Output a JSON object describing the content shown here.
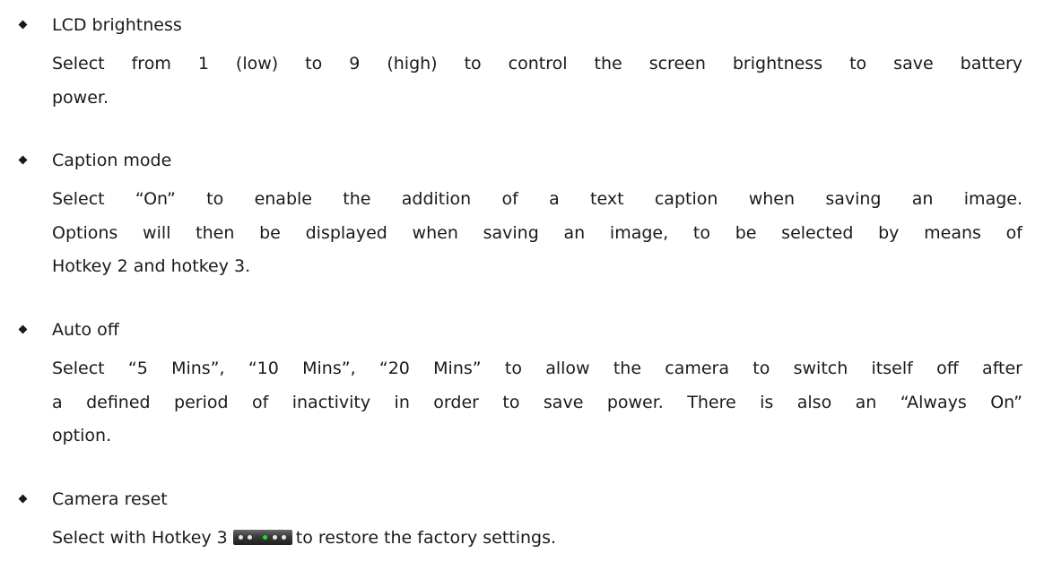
{
  "items": [
    {
      "heading": "LCD brightness",
      "lines": [
        "Select from 1 (low) to 9 (high) to control the screen brightness to save battery",
        "power."
      ]
    },
    {
      "heading": "Caption mode",
      "lines": [
        "Select “On” to enable the addition of a text caption when saving an image.",
        "Options will then be displayed when saving an image, to be selected by means of",
        "Hotkey 2 and hotkey 3."
      ]
    },
    {
      "heading": "Auto off",
      "lines": [
        "Select “5 Mins”, “10 Mins”, “20 Mins” to allow the camera to switch itself off after",
        "a defined period of inactivity in order to save power. There is also an “Always On”",
        "option."
      ]
    },
    {
      "heading": "Camera reset",
      "line_before_icon": "Select with Hotkey 3",
      "icon": "hotkey-3-indicator-icon",
      "line_after_icon": "to restore the factory settings."
    }
  ],
  "colors": {
    "text": "#1a1a1a",
    "indicator_active": "#23e02a",
    "indicator_idle": "#e8e8e8"
  }
}
